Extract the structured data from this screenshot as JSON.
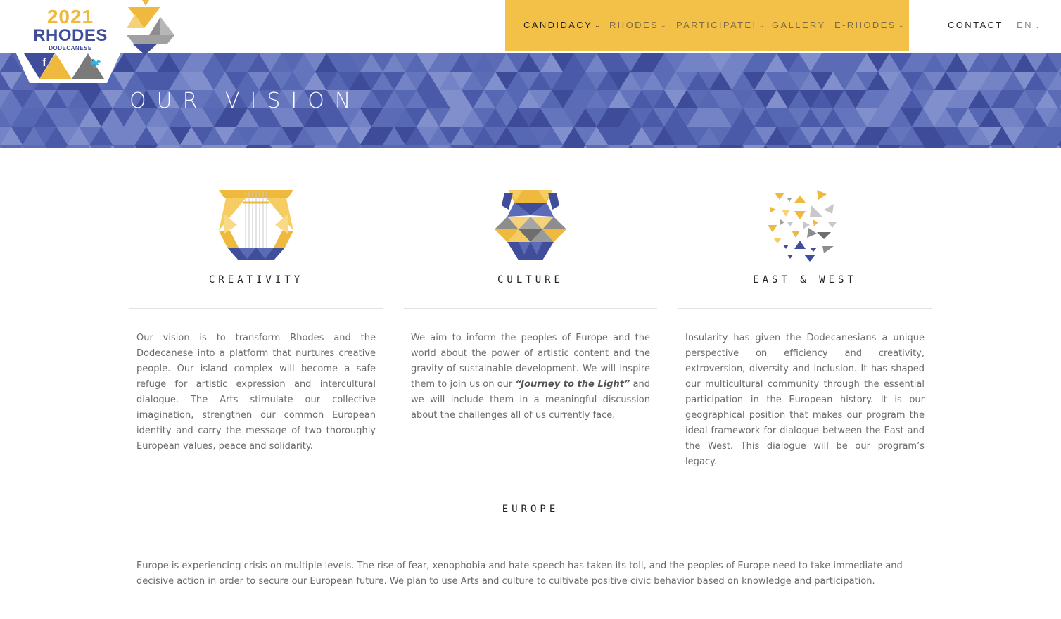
{
  "header": {
    "logo": {
      "year": "2021",
      "city": "RHODES",
      "region": "DODECANESE"
    },
    "social": [
      {
        "name": "facebook-icon",
        "glyph": "f"
      },
      {
        "name": "instagram-icon",
        "glyph": "◘"
      },
      {
        "name": "twitter-icon",
        "glyph": "🐦"
      }
    ],
    "nav": {
      "candidacy": "CANDIDACY",
      "rhodes": "RHODES",
      "participate": "PARTICIPATE!",
      "gallery": "GALLERY",
      "erhodes": "E-RHODES",
      "contact": "CONTACT",
      "language": "EN"
    },
    "colors": {
      "accent": "#f3c147",
      "brand_blue": "#3f4d9b",
      "banner": "#5b6bb5"
    }
  },
  "banner": {
    "title": "OUR VISION"
  },
  "columns": {
    "creativity": {
      "title": "CREATIVITY",
      "text": "Our vision is to transform Rhodes and the Dodecanese into a platform that nurtures creative people. Our island complex will become a safe refuge for artistic expression and intercultural dialogue. The Arts stimulate our collective imagination, strengthen our common European identity and carry the message of two thoroughly European values, peace and solidarity."
    },
    "culture": {
      "title": "CULTURE",
      "text_before": "We aim to inform the peoples of Europe and the world about the power of artistic content and the gravity of sustainable development. We will inspire them to join us on our ",
      "text_emphasis": "“Journey to the Light”",
      "text_after": " and we will include them in a meaningful discussion about the challenges all of us currently face."
    },
    "eastwest": {
      "title": "EAST & WEST",
      "text": "Insularity has given the Dodecanesians a unique perspective on efficiency and creativity, extroversion, diversity and inclusion. It has shaped our multicultural community through the essential participation in the European history. It is our geographical position that makes our program the ideal framework for dialogue between the East and the West. This dialogue will be our program’s legacy."
    }
  },
  "europe": {
    "title": "EUROPE",
    "text": "Europe is experiencing crisis on multiple levels. The rise of fear, xenophobia and hate speech has taken its toll, and the peoples of Europe need to take immediate and decisive action in order to secure our European future. We plan to use Arts and culture to cultivate positive civic behavior based on knowledge and participation."
  }
}
